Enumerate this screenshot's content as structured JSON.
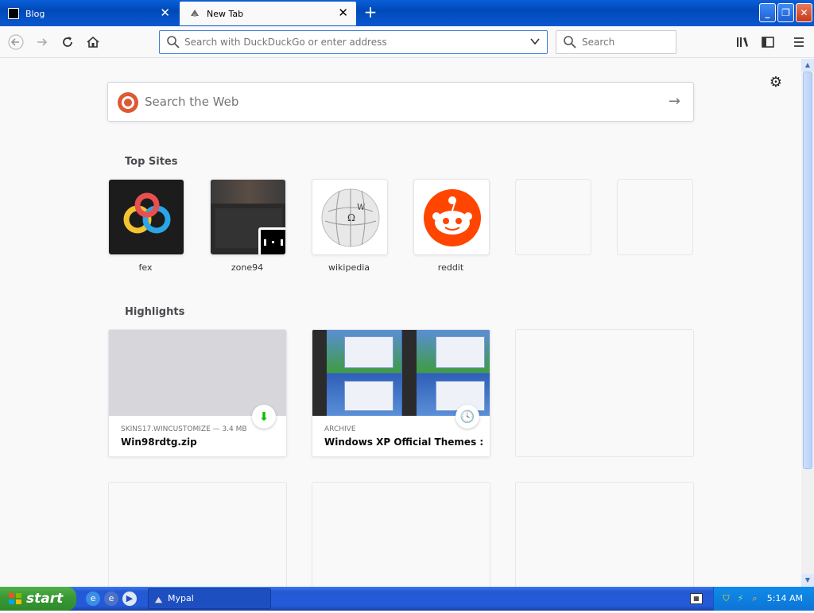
{
  "tabs": [
    {
      "label": "Blog"
    },
    {
      "label": "New Tab"
    }
  ],
  "nav": {
    "url_placeholder": "Search with DuckDuckGo or enter address",
    "search_placeholder": "Search"
  },
  "newtab": {
    "web_search_placeholder": "Search the Web",
    "top_sites_title": "Top Sites",
    "top_sites": [
      {
        "label": "fex"
      },
      {
        "label": "zone94"
      },
      {
        "label": "wikipedia"
      },
      {
        "label": "reddit"
      }
    ],
    "highlights_title": "Highlights",
    "highlights": [
      {
        "context": "SKINS17.WINCUSTOMIZE — 3.4 MB",
        "title": "Win98rdtg.zip"
      },
      {
        "context": "ARCHIVE",
        "title": "Windows XP Official Themes : M..."
      }
    ]
  },
  "taskbar": {
    "start_label": "start",
    "task_label": "Mypal",
    "clock": "5:14 AM"
  }
}
